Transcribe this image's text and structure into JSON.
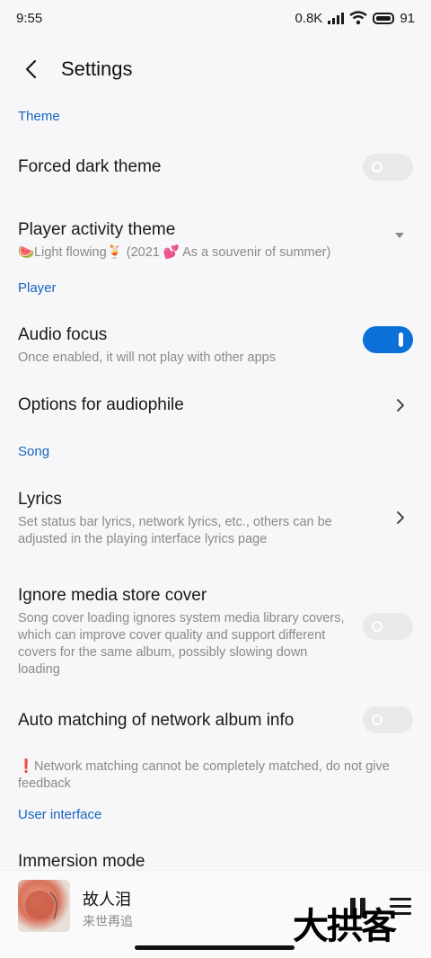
{
  "status_bar": {
    "time": "9:55",
    "net_speed": "0.8K",
    "battery": "91"
  },
  "header": {
    "title": "Settings"
  },
  "sections": {
    "theme": "Theme",
    "player": "Player",
    "song": "Song",
    "user_interface": "User interface"
  },
  "settings": {
    "forced_dark": {
      "title": "Forced dark theme",
      "enabled": false
    },
    "player_activity": {
      "title": "Player activity theme",
      "value": "🍉Light flowing🍹 (2021 💕 As a souvenir of summer)"
    },
    "audio_focus": {
      "title": "Audio focus",
      "subtitle": "Once enabled, it will not play with other apps",
      "enabled": true
    },
    "audiophile": {
      "title": "Options for audiophile"
    },
    "lyrics": {
      "title": "Lyrics",
      "subtitle": "Set status bar lyrics, network lyrics, etc., others can be adjusted in the playing interface lyrics page"
    },
    "ignore_cover": {
      "title": "Ignore media store cover",
      "subtitle": "Song cover loading ignores system media library covers, which can improve cover quality and support different covers for the same album, possibly slowing down loading",
      "enabled": false
    },
    "auto_match": {
      "title": "Auto matching of network album info",
      "enabled": false,
      "note": "❗Network matching cannot be completely matched, do not give feedback"
    },
    "immersion": {
      "title": "Immersion mode"
    }
  },
  "player_bar": {
    "song_title": "故人泪",
    "artist": "来世再追"
  },
  "watermark": "大拱客",
  "colors": {
    "accent": "#0b71d9",
    "section": "#1565c0",
    "background": "#f7f7f9"
  },
  "icons": [
    "back-arrow-icon",
    "wifi-icon",
    "signal-icon",
    "battery-icon",
    "chevron-right-icon",
    "dropdown-arrow-icon",
    "pause-icon",
    "playlist-icon"
  ]
}
